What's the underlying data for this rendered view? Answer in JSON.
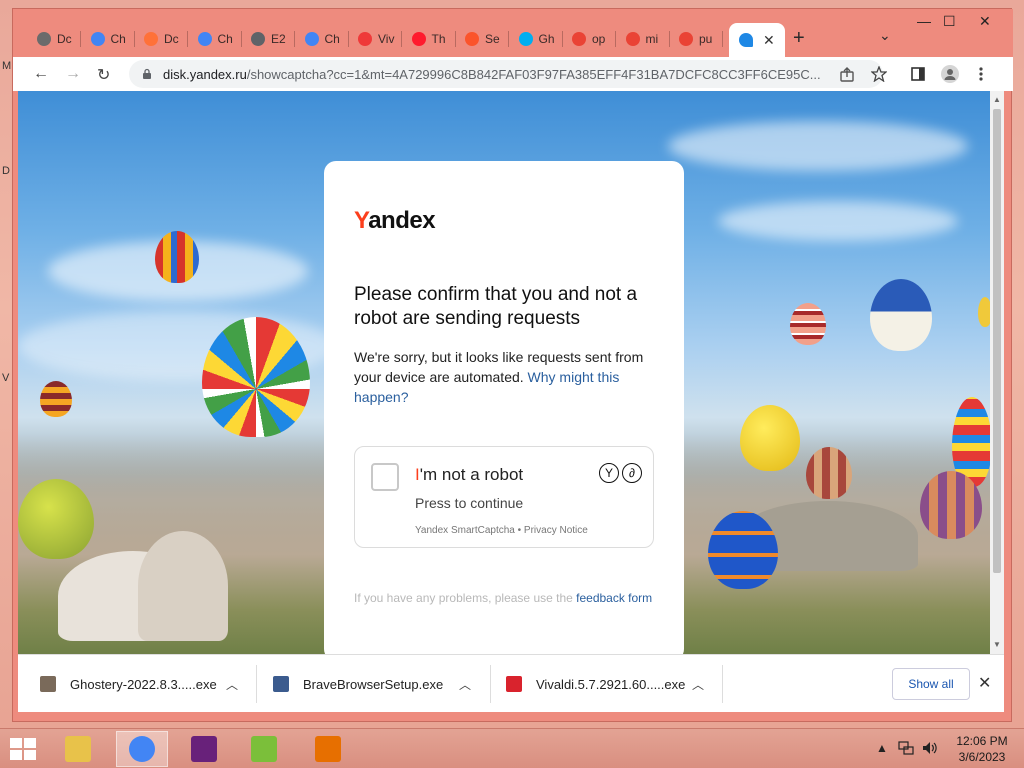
{
  "desktop_letters": [
    "M",
    "D",
    "V"
  ],
  "tabs": [
    {
      "label": "Dc",
      "icon": "download-icon",
      "color": "#6b6b6b"
    },
    {
      "label": "Ch",
      "icon": "chrome-icon",
      "color": "#4285f4"
    },
    {
      "label": "Dc",
      "icon": "firefox-icon",
      "color": "#ff7139"
    },
    {
      "label": "Ch",
      "icon": "chrome-icon",
      "color": "#4285f4"
    },
    {
      "label": "E2",
      "icon": "globe-icon",
      "color": "#5f6368"
    },
    {
      "label": "Ch",
      "icon": "chrome-icon",
      "color": "#4285f4"
    },
    {
      "label": "Viv",
      "icon": "vivaldi-icon",
      "color": "#ef3939"
    },
    {
      "label": "Th",
      "icon": "opera-icon",
      "color": "#ff1b2d"
    },
    {
      "label": "Se",
      "icon": "brave-icon",
      "color": "#fb542b"
    },
    {
      "label": "Gh",
      "icon": "ghostery-icon",
      "color": "#00aef0"
    },
    {
      "label": "op",
      "icon": "google-icon",
      "color": "#ea4335"
    },
    {
      "label": "mi",
      "icon": "google-icon",
      "color": "#ea4335"
    },
    {
      "label": "pu",
      "icon": "google-icon",
      "color": "#ea4335"
    }
  ],
  "active_tab": {
    "icon": "yandex-disk-icon",
    "close": "✕"
  },
  "window_controls": {
    "minimize": "—",
    "maximize": "☐",
    "close": "✕"
  },
  "new_tab": "+",
  "tab_list": "⌄",
  "nav": {
    "back": "←",
    "forward": "→",
    "reload": "↻"
  },
  "url": {
    "host": "disk.yandex.ru",
    "rest": "/showcaptcha?cc=1&mt=4A729996C8B842FAF03F97FA385EFF4F31BA7DCFC8CC3FF6CE95C..."
  },
  "captcha": {
    "logo_first": "Y",
    "logo_rest": "andex",
    "heading": "Please confirm that you and not a robot are sending requests",
    "description": "We're sorry, but it looks like requests sent from your device are automated. ",
    "why_link": "Why might this happen?",
    "checkbox_label_first": "I",
    "checkbox_label_rest": "'m not a robot",
    "press": "Press to continue",
    "smart_footer": "Yandex SmartCaptcha • Privacy Notice",
    "smart_logo": [
      "Y",
      "∂"
    ],
    "feedback_text": "If you have any problems, please use the ",
    "feedback_link": "feedback form"
  },
  "downloads": [
    {
      "name": "Ghostery-2022.8.3.....exe",
      "icon": "ghostery-installer-icon",
      "color": "#7a6a5a"
    },
    {
      "name": "BraveBrowserSetup.exe",
      "icon": "installer-icon",
      "color": "#3b5b8e"
    },
    {
      "name": "Vivaldi.5.7.2921.60.....exe",
      "icon": "vivaldi-installer-icon",
      "color": "#d9232d"
    }
  ],
  "downloads_show_all": "Show all",
  "downloads_close": "✕",
  "taskbar": {
    "apps": [
      {
        "name": "file-explorer",
        "color": "#e8c24a"
      },
      {
        "name": "chrome",
        "color": "#4285f4"
      },
      {
        "name": "visual-studio",
        "color": "#68217a"
      },
      {
        "name": "notepad-plus-plus",
        "color": "#7bbf3a"
      },
      {
        "name": "java",
        "color": "#e76f00"
      }
    ],
    "time": "12:06 PM",
    "date": "3/6/2023",
    "tray_up": "▲"
  }
}
